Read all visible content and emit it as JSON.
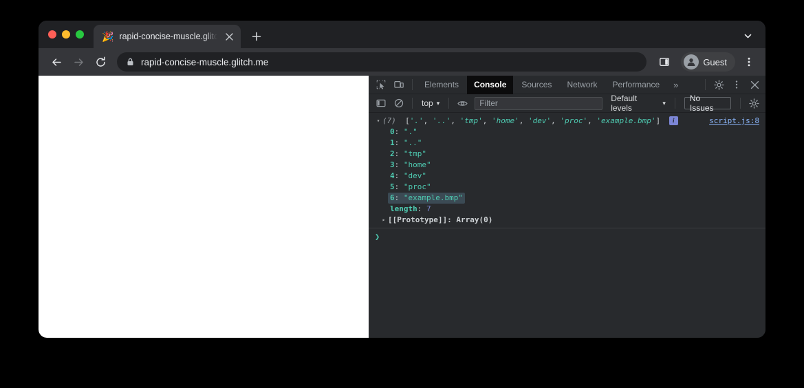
{
  "browser": {
    "tab": {
      "favicon": "party-popper",
      "title": "rapid-concise-muscle.glitch.me",
      "close_label": "✕"
    },
    "new_tab_label": "+",
    "tab_search_icon": "chevron-down-icon",
    "toolbar": {
      "back_icon": "←",
      "forward_icon": "→",
      "reload_icon": "⟳",
      "lock_icon": "lock-icon",
      "url": "rapid-concise-muscle.glitch.me",
      "side_panel_icon": "side-panel-icon",
      "profile_name": "Guest",
      "menu_icon": "⋮"
    }
  },
  "devtools": {
    "left_icons": [
      {
        "name": "inspect-element-icon"
      },
      {
        "name": "device-toolbar-icon"
      }
    ],
    "tabs": [
      {
        "label": "Elements",
        "active": false
      },
      {
        "label": "Console",
        "active": true
      },
      {
        "label": "Sources",
        "active": false
      },
      {
        "label": "Network",
        "active": false
      },
      {
        "label": "Performance",
        "active": false
      }
    ],
    "more_tabs_label": "»",
    "right_icons": [
      {
        "name": "settings-gear-icon"
      },
      {
        "name": "more-options-icon"
      },
      {
        "name": "close-devtools-icon"
      }
    ],
    "filterbar": {
      "sidebar_toggle_icon": "console-sidebar-icon",
      "clear_console_icon": "clear-console-icon",
      "context_value": "top",
      "context_caret": "▾",
      "live_expression_icon": "eye-icon",
      "filter_placeholder": "Filter",
      "filter_value": "",
      "levels_value": "Default levels",
      "levels_caret": "▾",
      "issues_label": "No Issues",
      "settings_icon": "console-settings-gear-icon"
    },
    "console": {
      "entry": {
        "count_label": "(7)",
        "preview": {
          "open_bracket": "[",
          "items": [
            "'.'",
            "'..'",
            "'tmp'",
            "'home'",
            "'dev'",
            "'proc'",
            "'example.bmp'"
          ],
          "separator": ", ",
          "close_bracket": "]"
        },
        "info_badge": "i",
        "source_link": "script.js:8",
        "properties": [
          {
            "index": "0",
            "value": "\".\"",
            "selected": false
          },
          {
            "index": "1",
            "value": "\"..\"",
            "selected": false
          },
          {
            "index": "2",
            "value": "\"tmp\"",
            "selected": false
          },
          {
            "index": "3",
            "value": "\"home\"",
            "selected": false
          },
          {
            "index": "4",
            "value": "\"dev\"",
            "selected": false
          },
          {
            "index": "5",
            "value": "\"proc\"",
            "selected": false
          },
          {
            "index": "6",
            "value": "\"example.bmp\"",
            "selected": true
          }
        ],
        "length_key": "length",
        "length_value": "7",
        "prototype_key": "[[Prototype]]",
        "prototype_value": "Array(0)",
        "separator": ": "
      },
      "prompt_caret": "❯"
    }
  },
  "colors": {
    "window_bg": "#202124",
    "toolbar_bg": "#35363a",
    "devtools_bg": "#282a2d",
    "active_tab_bg": "#0b0b0c",
    "string_teal": "#4ec9b0",
    "number_purple": "#7986cb",
    "link_blue": "#8ab4f8",
    "selection_bg": "#3b4a54",
    "page_bg": "#ffffff"
  }
}
